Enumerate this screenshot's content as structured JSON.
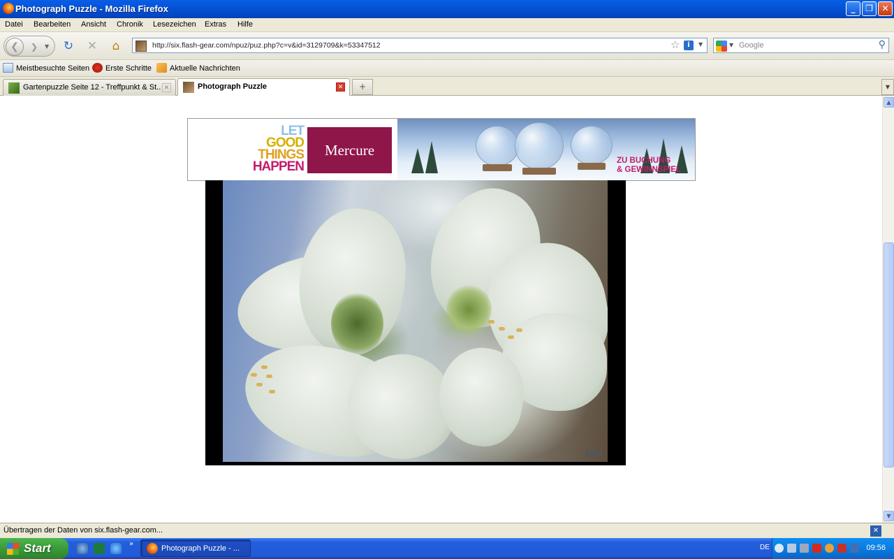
{
  "window": {
    "title": "Photograph Puzzle - Mozilla Firefox",
    "min": "_",
    "max": "❐",
    "close": "✕"
  },
  "menu": [
    "Datei",
    "Bearbeiten",
    "Ansicht",
    "Chronik",
    "Lesezeichen",
    "Extras",
    "Hilfe"
  ],
  "nav": {
    "url": "http://six.flash-gear.com/npuz/puz.php?c=v&id=3129709&k=53347512",
    "search_placeholder": "Google"
  },
  "bookmarks": [
    "Meistbesuchte Seiten",
    "Erste Schritte",
    "Aktuelle Nachrichten"
  ],
  "tabs": [
    {
      "label": "Gartenpuzzle Seite 12 - Treffpunkt & St...",
      "active": false
    },
    {
      "label": "Photograph Puzzle",
      "active": true
    }
  ],
  "ad": {
    "slogan": [
      "LET",
      "GOOD",
      "THINGS",
      "HAPPEN"
    ],
    "brand": "Mercure",
    "cta": [
      "ZU BUCHUNG",
      "& GEWINNSPIEL"
    ]
  },
  "status": {
    "text": "Übertragen der Daten von six.flash-gear.com..."
  },
  "taskbar": {
    "start": "Start",
    "task": "Photograph Puzzle - ...",
    "lang": "DE",
    "clock": "09:56"
  },
  "colors": {
    "accent": "#0a5ee6",
    "brand": "#8e1648",
    "slogan_pink": "#c21c6e"
  }
}
